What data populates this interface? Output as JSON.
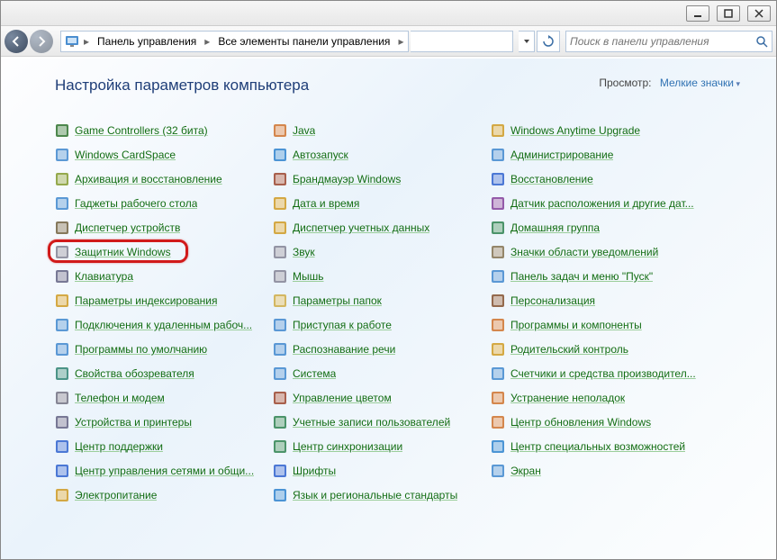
{
  "breadcrumb": {
    "seg1": "Панель управления",
    "seg2": "Все элементы панели управления"
  },
  "search": {
    "placeholder": "Поиск в панели управления"
  },
  "heading": "Настройка параметров компьютера",
  "view": {
    "label": "Просмотр:",
    "mode": "Мелкие значки"
  },
  "items": {
    "col1": [
      "Game Controllers (32 бита)",
      "Windows CardSpace",
      "Архивация и восстановление",
      "Гаджеты рабочего стола",
      "Диспетчер устройств",
      "Защитник Windows",
      "Клавиатура",
      "Параметры индексирования",
      "Подключения к удаленным рабоч...",
      "Программы по умолчанию",
      "Свойства обозревателя",
      "Телефон и модем",
      "Устройства и принтеры",
      "Центр поддержки",
      "Центр управления сетями и общи...",
      "Электропитание"
    ],
    "col2": [
      "Java",
      "Автозапуск",
      "Брандмауэр Windows",
      "Дата и время",
      "Диспетчер учетных данных",
      "Звук",
      "Мышь",
      "Параметры папок",
      "Приступая к работе",
      "Распознавание речи",
      "Система",
      "Управление цветом",
      "Учетные записи пользователей",
      "Центр синхронизации",
      "Шрифты",
      "Язык и региональные стандарты"
    ],
    "col3": [
      "Windows Anytime Upgrade",
      "Администрирование",
      "Восстановление",
      "Датчик расположения и другие дат...",
      "Домашняя группа",
      "Значки области уведомлений",
      "Панель задач и меню \"Пуск\"",
      "Персонализация",
      "Программы и компоненты",
      "Родительский контроль",
      "Счетчики и средства производител...",
      "Устранение неполадок",
      "Центр обновления Windows",
      "Центр специальных возможностей",
      "Экран"
    ]
  },
  "icon_colors": {
    "col1": [
      "#3a7a3a",
      "#4a8ed0",
      "#8aa03a",
      "#4a8ed0",
      "#7a6a4a",
      "#8a8a9a",
      "#6a6a8a",
      "#d0a030",
      "#4a8ed0",
      "#4a8ed0",
      "#3a8a7a",
      "#7a7a8a",
      "#6a6a8a",
      "#3a6ad0",
      "#3a6ad0",
      "#d0a030"
    ],
    "col2": [
      "#d07a3a",
      "#3a8ad0",
      "#a0503a",
      "#d0a030",
      "#d0a030",
      "#8a8a9a",
      "#8a8a9a",
      "#d0b050",
      "#4a8ed0",
      "#4a8ed0",
      "#4a8ed0",
      "#a0503a",
      "#3a8a5a",
      "#3a8a5a",
      "#3a6ad0",
      "#3a8ad0"
    ],
    "col3": [
      "#d0a030",
      "#4a8ed0",
      "#3a6ad0",
      "#8a4aa0",
      "#3a8a5a",
      "#8a7a5a",
      "#4a8ed0",
      "#8a5a3a",
      "#d07a3a",
      "#d0a030",
      "#4a8ed0",
      "#d07a3a",
      "#d07a3a",
      "#3a8ad0",
      "#4a8ed0"
    ]
  }
}
